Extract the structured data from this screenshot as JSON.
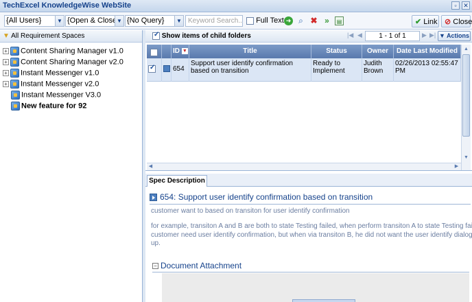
{
  "window": {
    "title": "TechExcel KnowledgeWise WebSite"
  },
  "toolbar": {
    "users_combo": "{All Users}",
    "status_combo": "{Open & Close}",
    "query_combo": "{No Query}",
    "keyword_placeholder": "Keyword Search...",
    "full_text_label": "Full Text",
    "link_label": "Link",
    "close_label": "Close"
  },
  "left_panel": {
    "header": "All Requirement Spaces",
    "items": [
      {
        "label": "Content Sharing Manager v1.0",
        "expandable": true
      },
      {
        "label": "Content Sharing Manager v2.0",
        "expandable": true
      },
      {
        "label": "Instant Messenger v1.0",
        "expandable": true
      },
      {
        "label": "Instant Messenger v2.0",
        "expandable": true
      },
      {
        "label": "Instant Messenger V3.0",
        "expandable": false
      },
      {
        "label": "New feature for 92",
        "expandable": false,
        "bold": true
      }
    ]
  },
  "grid": {
    "show_child_label": "Show items of child folders",
    "pager_text": "1 - 1 of 1",
    "actions_label": "Actions",
    "columns": [
      "ID",
      "Title",
      "Status",
      "Owner",
      "Date Last Modified"
    ],
    "rows": [
      {
        "id": "654",
        "title": "Support user identify confirmation based on transition",
        "status": "Ready to Implement",
        "owner": "Judith Brown",
        "date": "02/26/2013 02:55:47 PM"
      }
    ]
  },
  "spec": {
    "tab_label": "Spec Description",
    "title": "654: Support user identify confirmation based on transition",
    "line1": "customer want to based on transiton for user identify confirmation",
    "line2": "for example, transiton A and B are both to state Testing failed, when perform transiton A to state Testing faile",
    "line3": "customer need user identify confirmation, but when via transiton B, he did not want the user identify dialog p",
    "line4": "up.",
    "attachment_header": "Document Attachment"
  }
}
